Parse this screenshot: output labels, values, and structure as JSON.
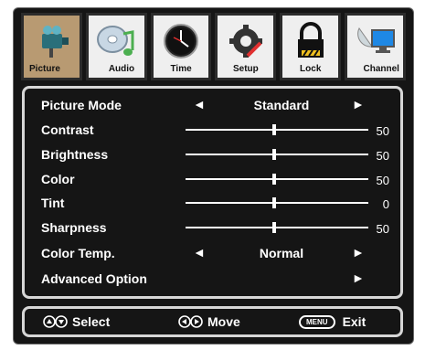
{
  "tabs": [
    {
      "label": "Picture",
      "icon": "camera-icon",
      "active": true
    },
    {
      "label": "Audio",
      "icon": "music-disc-icon",
      "active": false
    },
    {
      "label": "Time",
      "icon": "clock-icon",
      "active": false
    },
    {
      "label": "Setup",
      "icon": "gear-tools-icon",
      "active": false
    },
    {
      "label": "Lock",
      "icon": "padlock-icon",
      "active": false
    },
    {
      "label": "Channel",
      "icon": "satellite-tv-icon",
      "active": false
    }
  ],
  "menu": {
    "picture_mode": {
      "label": "Picture Mode",
      "value": "Standard"
    },
    "contrast": {
      "label": "Contrast",
      "value": "50"
    },
    "brightness": {
      "label": "Brightness",
      "value": "50"
    },
    "color": {
      "label": "Color",
      "value": "50"
    },
    "tint": {
      "label": "Tint",
      "value": "0"
    },
    "sharpness": {
      "label": "Sharpness",
      "value": "50"
    },
    "color_temp": {
      "label": "Color Temp.",
      "value": "Normal"
    },
    "advanced": {
      "label": "Advanced Option"
    }
  },
  "footer": {
    "select_label": "Select",
    "move_label": "Move",
    "menu_key": "MENU",
    "exit_label": "Exit"
  },
  "colors": {
    "active_tab": "#b89a72",
    "background": "#151515",
    "text": "#ffffff"
  }
}
